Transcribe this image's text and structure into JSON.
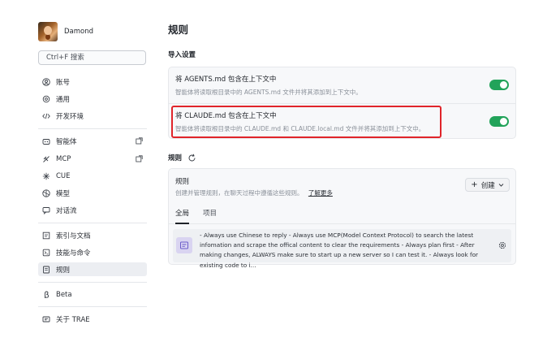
{
  "user": {
    "name": "Damond"
  },
  "search": {
    "placeholder": "Ctrl+F 搜索"
  },
  "sidebar": {
    "group1": [
      {
        "label": "账号",
        "icon": "user-circle-icon"
      },
      {
        "label": "通用",
        "icon": "gear-icon"
      },
      {
        "label": "开发环境",
        "icon": "code-icon"
      }
    ],
    "group2": [
      {
        "label": "智能体",
        "icon": "robot-icon"
      },
      {
        "label": "MCP",
        "icon": "mcp-icon"
      },
      {
        "label": "CUE",
        "icon": "sparkle-icon"
      },
      {
        "label": "模型",
        "icon": "cube-icon"
      },
      {
        "label": "对话流",
        "icon": "chat-flow-icon"
      }
    ],
    "group3": [
      {
        "label": "索引与文档",
        "icon": "index-icon"
      },
      {
        "label": "技能与命令",
        "icon": "skill-icon"
      },
      {
        "label": "规则",
        "icon": "rules-icon"
      }
    ],
    "group4": [
      {
        "label": "Beta",
        "icon": "beta-icon"
      }
    ],
    "group5": [
      {
        "label": "关于 TRAE",
        "icon": "info-icon"
      }
    ]
  },
  "main": {
    "title": "规则",
    "import_section": {
      "title": "导入设置",
      "rows": [
        {
          "title": "将 AGENTS.md 包含在上下文中",
          "desc": "智能体将读取根目录中的 AGENTS.md 文件并将其添加到上下文中。",
          "enabled": true
        },
        {
          "title": "将 CLAUDE.md 包含在上下文中",
          "desc": "智能体将读取根目录中的 CLAUDE.md 和 CLAUDE.local.md 文件并将其添加到上下文中。",
          "enabled": true
        }
      ]
    },
    "rules_section": {
      "title": "规则",
      "card_title": "规则",
      "card_desc": "创建并管理规则，在聊天过程中遵循这些规则。",
      "learn_more": "了解更多",
      "create_label": "创建",
      "tabs": [
        "全局",
        "项目"
      ],
      "rule_text": "- Always use Chinese to reply - Always use MCP(Model Context Protocol) to search the latest infomation and scrape the offical content to clear the requirements - Always plan first - After making changes, ALWAYS make sure to start up a new server so I can test it. - Always look for existing code to i..."
    }
  },
  "colors": {
    "toggle_on": "#22a35a",
    "highlight": "#e0242a",
    "accent_bg": "#d9d4f1"
  }
}
